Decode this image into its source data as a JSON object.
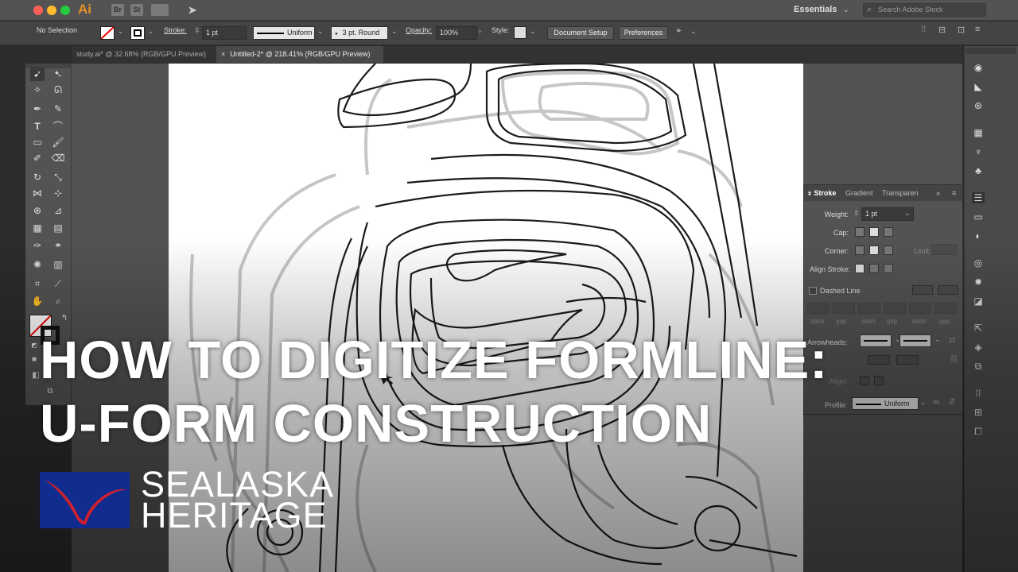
{
  "titlebar": {
    "app_logo": "Ai",
    "bridge_label": "Br",
    "stock_label": "St",
    "workspace": "Essentials",
    "search_placeholder": "Search Adobe Stock"
  },
  "controlbar": {
    "selection": "No Selection",
    "stroke_label": "Stroke:",
    "stroke_weight": "1 pt",
    "profile": "Uniform",
    "brush": "3 pt. Round",
    "opacity_label": "Opacity:",
    "opacity": "100%",
    "style_label": "Style:",
    "document_setup": "Document Setup",
    "preferences": "Preferences"
  },
  "tabs": [
    {
      "label": "study.ai* @ 32.68% (RGB/GPU Preview)"
    },
    {
      "label": "Untitled-2* @ 218.41% (RGB/GPU Preview)"
    }
  ],
  "stroke_panel": {
    "tabs": [
      "Stroke",
      "Gradient",
      "Transparen"
    ],
    "weight_label": "Weight:",
    "weight": "1 pt",
    "cap_label": "Cap:",
    "corner_label": "Corner:",
    "limit_label": "Limit:",
    "align_label": "Align Stroke:",
    "dashed_label": "Dashed Line",
    "dash_labels": [
      "dash",
      "gap",
      "dash",
      "gap",
      "dash",
      "gap"
    ],
    "arrowheads_label": "Arrowheads:",
    "align_label2": "Align:",
    "profile_label": "Profile:",
    "profile": "Uniform"
  },
  "overlay": {
    "title_line1": "HOW TO DIGITIZE FORMLINE:",
    "title_line2": "U-FORM CONSTRUCTION",
    "org_line1": "SEALASKA",
    "org_line2": "HERITAGE"
  },
  "colors": {
    "accent": "#e8922a",
    "logo_blue": "#0f2c8e",
    "logo_red": "#d0202f"
  }
}
